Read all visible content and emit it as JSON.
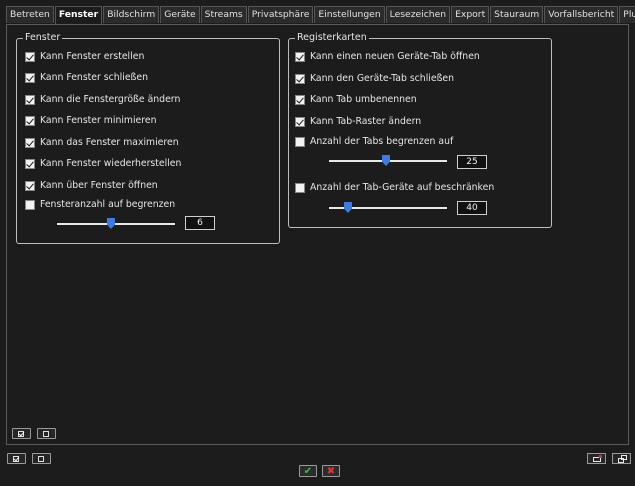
{
  "tabs": [
    "Betreten",
    "Fenster",
    "Bildschirm",
    "Geräte",
    "Streams",
    "Privatsphäre",
    "Einstellungen",
    "Lesezeichen",
    "Export",
    "Stauraum",
    "Vorfallsbericht",
    "Plugins"
  ],
  "active_tab": "Fenster",
  "fenster_group": {
    "title": "Fenster",
    "options": [
      {
        "label": "Kann Fenster erstellen",
        "checked": true
      },
      {
        "label": "Kann Fenster schließen",
        "checked": true
      },
      {
        "label": "Kann die Fenstergröße ändern",
        "checked": true
      },
      {
        "label": "Kann Fenster minimieren",
        "checked": true
      },
      {
        "label": "Kann das Fenster maximieren",
        "checked": true
      },
      {
        "label": "Kann Fenster wiederherstellen",
        "checked": true
      },
      {
        "label": "Kann über Fenster öffnen",
        "checked": true
      },
      {
        "label": "Fensteranzahl auf begrenzen",
        "checked": false
      }
    ],
    "limit_value": "6",
    "limit_slider_fraction": 0.45
  },
  "register_group": {
    "title": "Registerkarten",
    "options": [
      {
        "label": "Kann einen neuen Geräte-Tab öffnen",
        "checked": true
      },
      {
        "label": "Kann den Geräte-Tab schließen",
        "checked": true
      },
      {
        "label": "Kann Tab umbenennen",
        "checked": true
      },
      {
        "label": "Kann Tab-Raster ändern",
        "checked": true
      }
    ],
    "tabs_limit": {
      "label": "Anzahl der Tabs begrenzen auf",
      "checked": false,
      "value": "25",
      "slider_fraction": 0.48
    },
    "devices_limit": {
      "label": "Anzahl der Tab-Geräte auf beschränken",
      "checked": false,
      "value": "40",
      "slider_fraction": 0.14
    }
  },
  "colors": {
    "accent": "#3d7be0",
    "ok": "#3fbf3f",
    "cancel": "#e03333"
  }
}
